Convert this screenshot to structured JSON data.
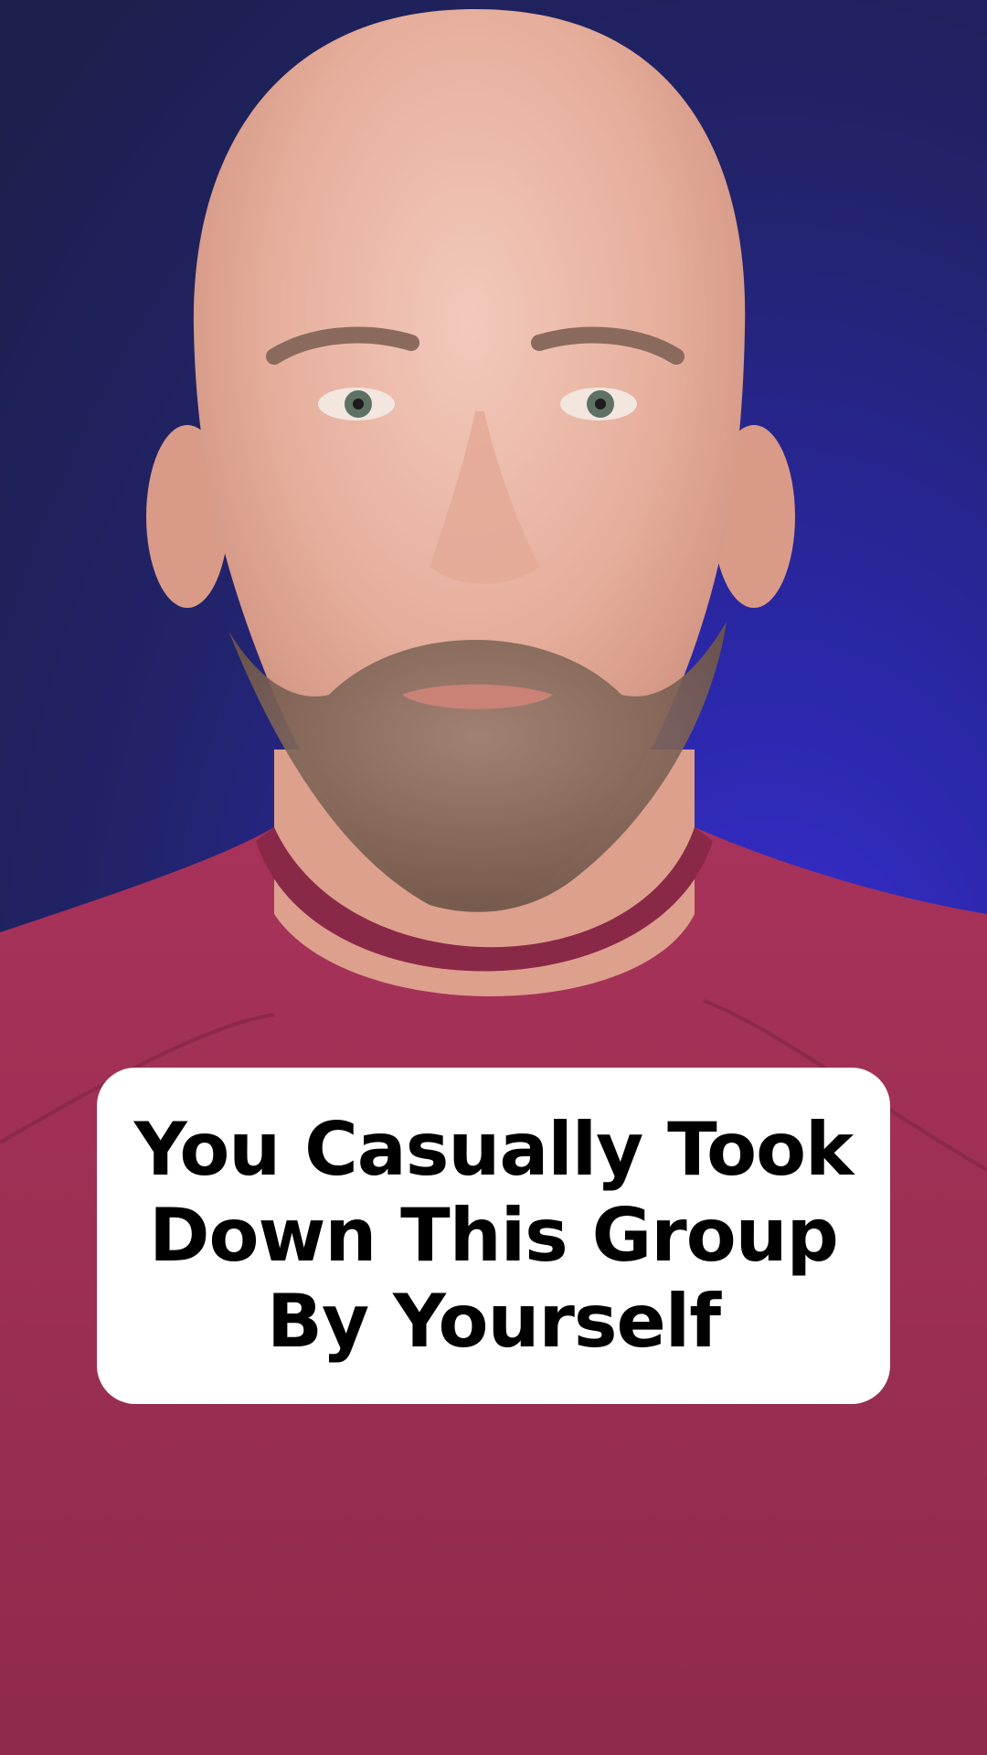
{
  "caption": {
    "lines": [
      "You Casually Took",
      "Down This Group",
      "By Yourself"
    ]
  },
  "colors": {
    "background": "#2b27a8",
    "shirt": "#9e2f52",
    "skin": "#e9b7a6",
    "caption_bg": "#ffffff",
    "caption_text": "#000000"
  }
}
